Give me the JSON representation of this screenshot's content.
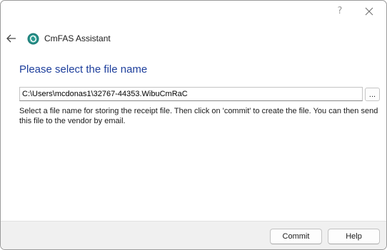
{
  "window": {
    "help_glyph": "?",
    "close_icon": "close-icon"
  },
  "header": {
    "back_icon": "back-arrow-icon",
    "logo_icon": "cmfas-logo-icon",
    "app_title": "CmFAS Assistant"
  },
  "main": {
    "heading": "Please select the file name",
    "file_path": "C:\\Users\\mcdonas1\\32767-44353.WibuCmRaC",
    "browse_label": "...",
    "description": "Select a file name for storing the receipt file. Then click on 'commit' to create the file. You can then send this file to the vendor by email."
  },
  "footer": {
    "commit_label": "Commit",
    "help_label": "Help"
  },
  "colors": {
    "heading": "#1e3f9c",
    "logo": "#1f7c78",
    "footer_bg": "#f0f0f0"
  }
}
